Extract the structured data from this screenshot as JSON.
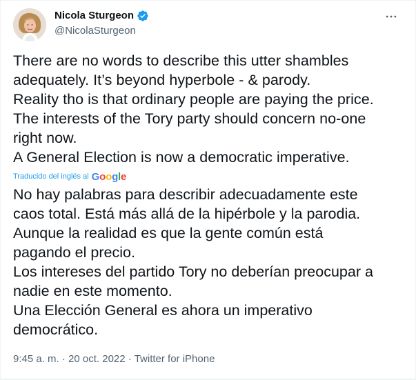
{
  "author": {
    "display_name": "Nicola Sturgeon",
    "handle": "@NicolaSturgeon",
    "verified": true,
    "avatar_icon": "profile-photo"
  },
  "menu": {
    "more_icon": "more-horizontal-icon"
  },
  "tweet": {
    "original_lines": [
      "There are no words to describe this utter shambles",
      "adequately. It’s beyond hyperbole - & parody.",
      "Reality tho is that ordinary people are paying the price.",
      "The interests of the Tory party should concern no-one",
      "right now.",
      "A General Election is now a democratic imperative."
    ],
    "translation_label": "Traducido del inglés al",
    "translation_provider": "Google",
    "translated_lines": [
      "No hay palabras para describir adecuadamente este",
      "caos total. Está más allá de la hipérbole y la parodia.",
      "Aunque la realidad es que la gente común está",
      "pagando el precio.",
      "Los intereses del partido Tory no deberían preocupar a",
      "nadie en este momento.",
      "Una Elección General es ahora un imperativo",
      "democrático."
    ]
  },
  "meta": {
    "time": "9:45 a. m.",
    "separator_1": " · ",
    "date": "20 oct. 2022",
    "separator_2": " · ",
    "source": "Twitter for iPhone"
  },
  "colors": {
    "text_primary": "#0f1419",
    "text_secondary": "#536471",
    "accent_blue": "#1d9bf0",
    "google_blue": "#4285F4",
    "google_red": "#EA4335",
    "google_yellow": "#FBBC05",
    "google_green": "#34A853"
  }
}
